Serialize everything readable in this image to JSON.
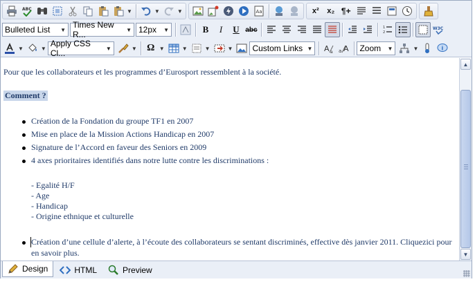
{
  "toolbar": {
    "paragraph_style": "Bulleted List",
    "font_name": "Times New R...",
    "font_size": "12px",
    "css_class": "Apply CSS Cl...",
    "links": "Custom Links",
    "zoom": "Zoom"
  },
  "content": {
    "intro": "Pour que les collaborateurs et les programmes d’Eurosport ressemblent à la société.",
    "heading": "Comment ?",
    "bullets": [
      "Création de la Fondation du groupe TF1 en 2007",
      "Mise en place de la Mission Actions Handicap en 2007",
      "Signature de l’Accord en faveur des Seniors en 2009",
      "4 axes prioritaires identifiés dans notre lutte contre les discriminations :"
    ],
    "sub_items": [
      "- Egalité H/F",
      "- Age",
      "- Handicap",
      "- Origine ethnique et culturelle"
    ],
    "last_bullet_line1": "Création d’une cellule d’alerte, à l’écoute des collaborateurs se sentant discriminés, effective dès janvier 2011. Cliquezici pour",
    "last_bullet_line2": "en savoir plus."
  },
  "modes": {
    "design": "Design",
    "html": "HTML",
    "preview": "Preview"
  },
  "colors": {
    "text": "#1f3a68",
    "toolbar_bg": "#eaeff7",
    "accent": "#3d6fb6"
  }
}
